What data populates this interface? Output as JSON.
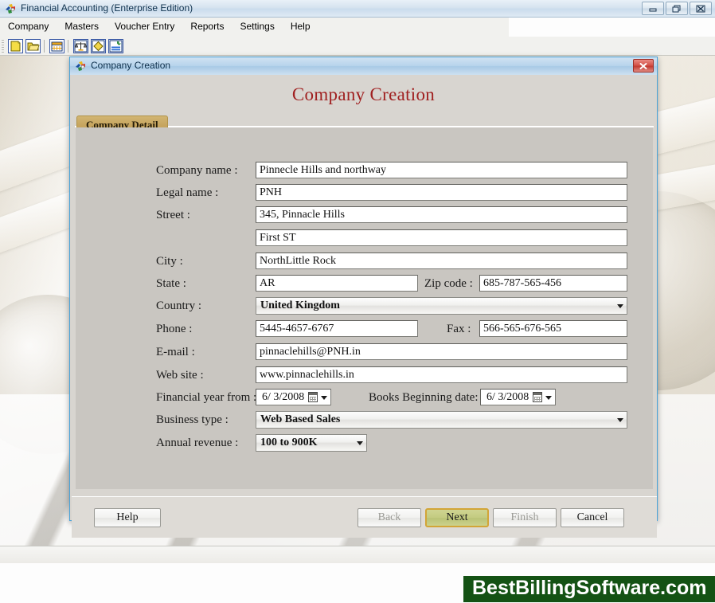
{
  "app": {
    "title": "Financial Accounting (Enterprise Edition)",
    "icon": "app-puzzle-icon",
    "window_buttons": [
      {
        "name": "minimize",
        "glyph": "minimize-icon"
      },
      {
        "name": "restore",
        "glyph": "restore-icon"
      },
      {
        "name": "close",
        "glyph": "close-icon"
      }
    ]
  },
  "menubar": {
    "items": [
      {
        "label": "Company"
      },
      {
        "label": "Masters"
      },
      {
        "label": "Voucher Entry"
      },
      {
        "label": "Reports"
      },
      {
        "label": "Settings"
      },
      {
        "label": "Help"
      }
    ]
  },
  "toolbar": {
    "items": [
      {
        "name": "new-company-icon"
      },
      {
        "name": "open-company-icon"
      },
      {
        "name": "calendar-icon"
      },
      {
        "name": "balance-scale-icon"
      },
      {
        "name": "ledger-icon"
      },
      {
        "name": "reports-icon"
      }
    ]
  },
  "dialog": {
    "titlebar_text": "Company Creation",
    "titlebar_icon": "app-puzzle-icon",
    "close_button": "close-icon",
    "heading": "Company Creation",
    "tab": {
      "label": "Company Detail",
      "active": true
    },
    "fields": [
      {
        "label": "Company name :",
        "value": "Pinnecle Hills and northway",
        "type": "text",
        "name": "company-name"
      },
      {
        "label": "Legal name :",
        "value": "PNH",
        "type": "text",
        "name": "legal-name"
      },
      {
        "label": "Street :",
        "value": "345, Pinnacle Hills",
        "type": "text",
        "name": "street-line-1"
      },
      {
        "label": "",
        "value": "First ST",
        "type": "text",
        "name": "street-line-2"
      },
      {
        "label": "City :",
        "value": "NorthLittle Rock",
        "type": "text",
        "name": "city"
      },
      {
        "label": "State :",
        "value": "AR",
        "type": "text",
        "name": "state"
      },
      {
        "label": "Zip code :",
        "value": "685-787-565-456",
        "type": "text",
        "name": "zip-code"
      },
      {
        "label": "Country :",
        "value": "United Kingdom",
        "type": "select",
        "name": "country"
      },
      {
        "label": "Phone :",
        "value": "5445-4657-6767",
        "type": "text",
        "name": "phone"
      },
      {
        "label": "Fax :",
        "value": "566-565-676-565",
        "type": "text",
        "name": "fax"
      },
      {
        "label": "E-mail :",
        "value": "pinnaclehills@PNH.in",
        "type": "text",
        "name": "email"
      },
      {
        "label": "Web site :",
        "value": "www.pinnaclehills.in",
        "type": "text",
        "name": "website"
      },
      {
        "label": "Financial year from :",
        "value": "6/  3/2008",
        "type": "date",
        "name": "financial-year-from"
      },
      {
        "label": "Books Beginning date:",
        "value": "6/  3/2008",
        "type": "date",
        "name": "books-beginning-date"
      },
      {
        "label": "Business type :",
        "value": "Web Based Sales",
        "type": "select",
        "name": "business-type"
      },
      {
        "label": "Annual revenue :",
        "value": "100 to 900K",
        "type": "select",
        "name": "annual-revenue"
      }
    ],
    "buttons": {
      "help": "Help",
      "back": "Back",
      "next": "Next",
      "finish": "Finish",
      "cancel": "Cancel"
    }
  },
  "watermark": {
    "text": "BestBillingSoftware.com"
  },
  "colors": {
    "heading": "#a02020",
    "tab_active": "#c6a55f",
    "next_highlight": "#d2a537",
    "next_fill": "#c3cb80",
    "watermark_bg": "#145214",
    "dialog_border": "#4aa3d8"
  }
}
